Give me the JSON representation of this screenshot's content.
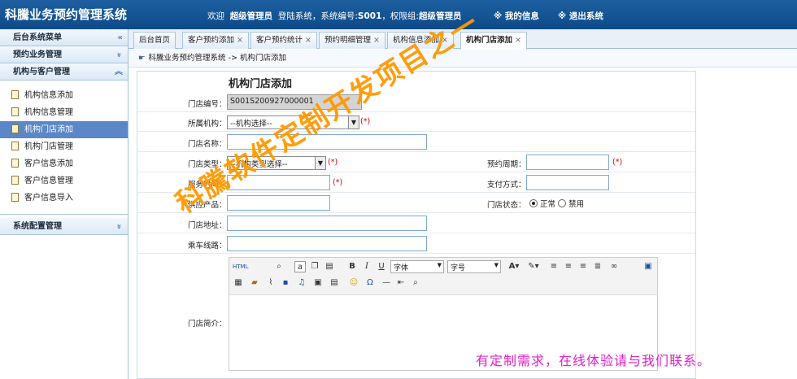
{
  "header": {
    "title": "科騰业务预约管理系统",
    "welcome_prefix": "欢迎",
    "user": "超级管理员",
    "system_info": "登陆系统，系统编号:",
    "system_no": "S001",
    "group_prefix": "，权限组:",
    "group": "超级管理员",
    "my_info": "※ 我的信息",
    "logout": "※ 退出系统"
  },
  "sidebar": {
    "sections": [
      {
        "label": "后台系统菜单",
        "chevron": "«"
      },
      {
        "label": "预约业务管理",
        "chevron": "»"
      },
      {
        "label": "机构与客户管理",
        "chevron": "︽"
      },
      {
        "label": "系统配置管理",
        "chevron": "»"
      }
    ],
    "items": [
      {
        "label": "机构信息添加",
        "active": false
      },
      {
        "label": "机构信息管理",
        "active": false
      },
      {
        "label": "机构门店添加",
        "active": true
      },
      {
        "label": "机构门店管理",
        "active": false
      },
      {
        "label": "客户信息添加",
        "active": false
      },
      {
        "label": "客户信息管理",
        "active": false
      },
      {
        "label": "客户信息导入",
        "active": false
      }
    ]
  },
  "tabs": [
    {
      "label": "后台首页",
      "closable": false
    },
    {
      "label": "客户预约添加",
      "closable": true
    },
    {
      "label": "客户预约统计",
      "closable": true
    },
    {
      "label": "预约明细管理",
      "closable": true
    },
    {
      "label": "机构信息添加",
      "closable": true
    },
    {
      "label": "机构门店添加",
      "closable": true,
      "active": true
    }
  ],
  "tab_close": "×",
  "breadcrumb": "科騰业务预约管理系统 -> 机构门店添加",
  "form": {
    "title": "机构门店添加",
    "store_no_label": "门店编号：",
    "store_no_value": "S001S200927000001",
    "org_label": "所属机构：",
    "org_select": "--机构选择--",
    "required_mark": "(*)",
    "store_name_label": "门店名称：",
    "store_type_label": "门店类型：",
    "store_type_select": "--机构类型选择--",
    "booking_period_label": "预约周期：",
    "service_time_label": "服务时间：",
    "payment_label": "支付方式：",
    "supply_label": "供应产品：",
    "status_label": "门店状态：",
    "status_normal": "正常",
    "status_disabled": "禁用",
    "address_label": "门店地址：",
    "route_label": "乘车线路：",
    "intro_label": "门店简介："
  },
  "editor": {
    "font_family": "字体",
    "font_size": "字号"
  },
  "watermark": {
    "main": "科騰软件定制开发项目之一",
    "footer": "有定制需求，在线体验请与我们联系。"
  },
  "colors": {
    "header_bg": "#0e4a8a",
    "active_item": "#5b87c9",
    "required": "#d10000",
    "watermark_main": "#ff9900",
    "watermark_footer": "#e020c8"
  }
}
